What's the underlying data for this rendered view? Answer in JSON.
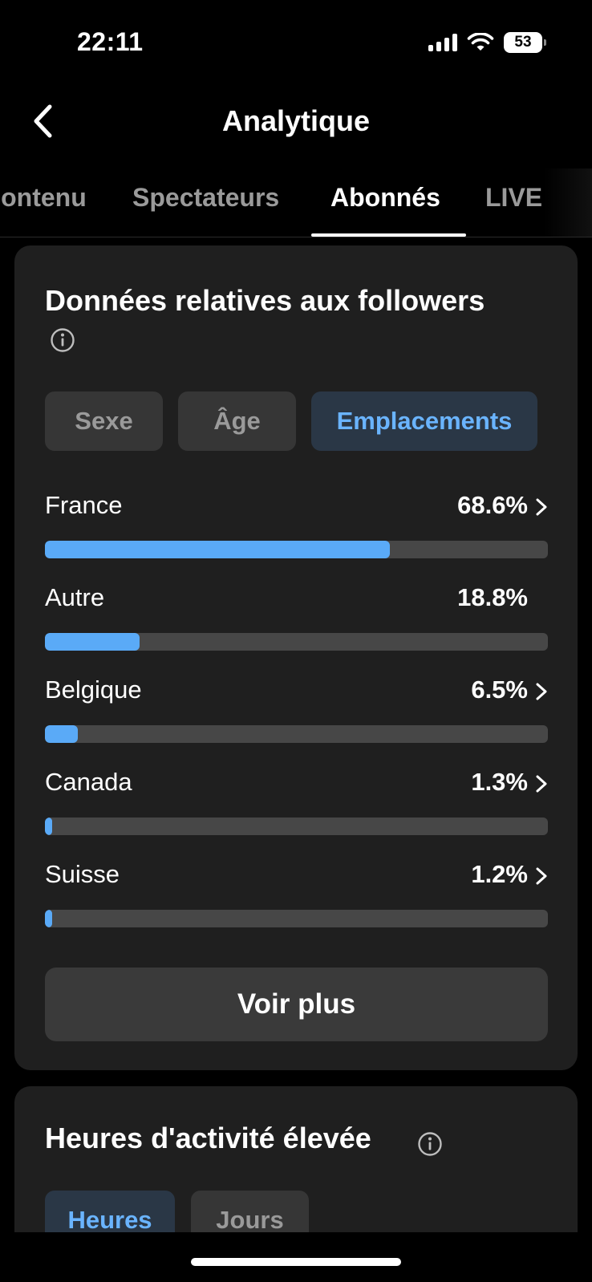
{
  "status_bar": {
    "time": "22:11",
    "battery": "53"
  },
  "header": {
    "title": "Analytique"
  },
  "tabs": [
    {
      "label": "Contenu",
      "active": false
    },
    {
      "label": "Spectateurs",
      "active": false
    },
    {
      "label": "Abonnés",
      "active": true
    },
    {
      "label": "LIVE",
      "active": false
    }
  ],
  "followers_card": {
    "title": "Données relatives aux followers",
    "segments": [
      {
        "label": "Sexe",
        "active": false
      },
      {
        "label": "Âge",
        "active": false
      },
      {
        "label": "Emplacements",
        "active": true
      }
    ],
    "locations": [
      {
        "label": "France",
        "value": "68.6%",
        "percent": 68.6,
        "has_chevron": true
      },
      {
        "label": "Autre",
        "value": "18.8%",
        "percent": 18.8,
        "has_chevron": false
      },
      {
        "label": "Belgique",
        "value": "6.5%",
        "percent": 6.5,
        "has_chevron": true
      },
      {
        "label": "Canada",
        "value": "1.3%",
        "percent": 1.3,
        "has_chevron": true
      },
      {
        "label": "Suisse",
        "value": "1.2%",
        "percent": 1.2,
        "has_chevron": true
      }
    ],
    "see_more_label": "Voir plus"
  },
  "activity_card": {
    "title": "Heures d'activité élevée",
    "segments": [
      {
        "label": "Heures",
        "active": true
      },
      {
        "label": "Jours",
        "active": false
      }
    ]
  },
  "colors": {
    "background": "#000000",
    "card": "#1f1f1f",
    "accent_blue": "#5aaaf7",
    "segment_active_text": "#6ab4ff",
    "bar_track": "#474747"
  }
}
